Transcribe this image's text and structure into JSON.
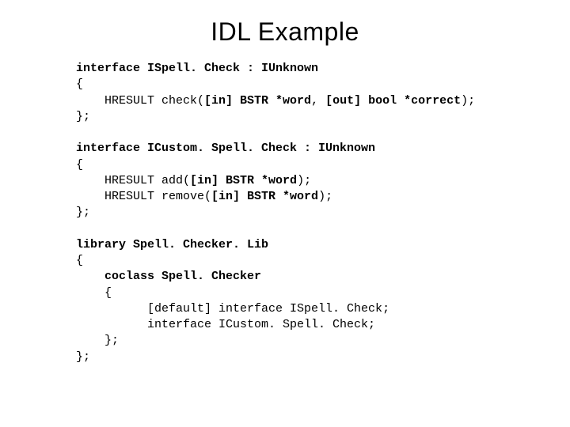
{
  "title": "IDL Example",
  "code": {
    "l1a": "interface ISpell. Check : IUnknown",
    "l2": "{",
    "l3a": "    HRESULT check(",
    "l3b": "[in] BSTR *word",
    "l3c": ", ",
    "l3d": "[out] bool *correct",
    "l3e": ");",
    "l4": "};",
    "l5": "",
    "l6a": "interface ICustom. Spell. Check : IUnknown",
    "l7": "{",
    "l8a": "    HRESULT add(",
    "l8b": "[in] BSTR *word",
    "l8c": ");",
    "l9a": "    HRESULT remove(",
    "l9b": "[in] BSTR *word",
    "l9c": ");",
    "l10": "};",
    "l11": "",
    "l12a": "library Spell. Checker. Lib",
    "l13": "{",
    "l14a": "    coclass Spell. Checker",
    "l15": "    {",
    "l16": "          [default] interface ISpell. Check;",
    "l17": "          interface ICustom. Spell. Check;",
    "l18": "    };",
    "l19": "};"
  }
}
